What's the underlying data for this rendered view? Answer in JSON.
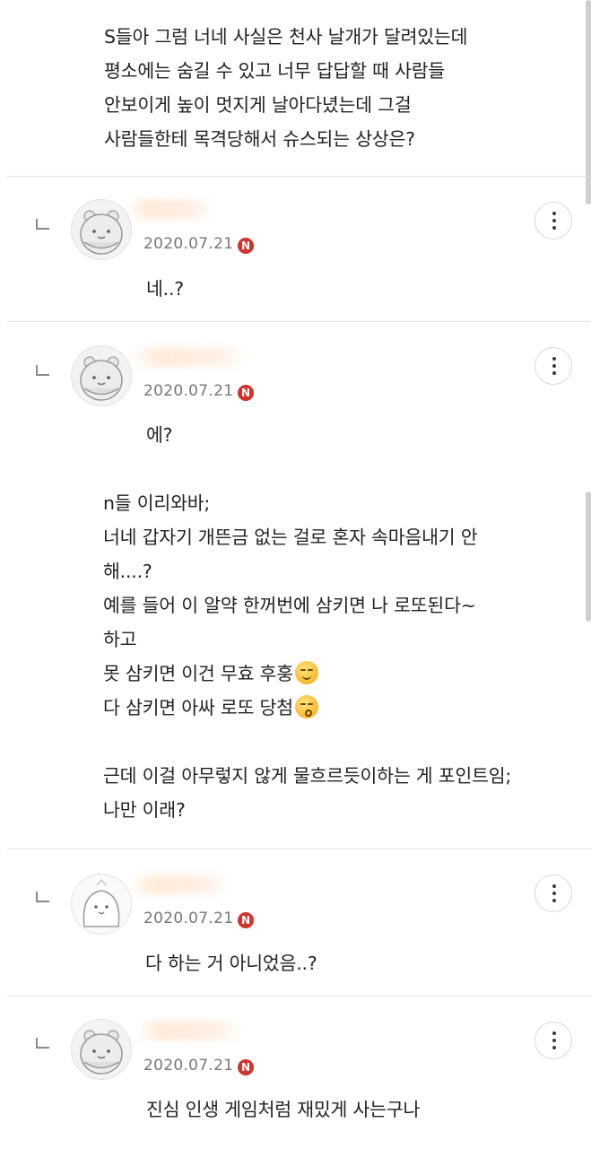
{
  "post": {
    "lines": [
      "S들아 그럼 너네 사실은 천사 날개가 달려있는데",
      "평소에는 숨길 수 있고 너무 답답할 때 사람들",
      "안보이게 높이 멋지게 날아다녔는데 그걸",
      "사람들한테 목격당해서 슈스되는 상상은?"
    ]
  },
  "comments": [
    {
      "date": "2020.07.21",
      "badge": "N",
      "text": "네..?",
      "avatar_icon": "hamster-avatar-icon"
    },
    {
      "date": "2020.07.21",
      "badge": "N",
      "text": "에?",
      "avatar_icon": "hamster-avatar-icon",
      "body_lines": [
        "n들 이리와바;",
        "너네 갑자기 개뜬금 없는 걸로 혼자 속마음내기 안",
        "해....?",
        "예를 들어 이 알약 한꺼번에 삼키면 나 로또된다~",
        "하고",
        "못 삼키면 이건 무효 후훙",
        "다 삼키면 아싸 로또 당첨",
        "",
        "근데 이걸 아무렇지 않게 물흐르듯이하는 게 포인트임;",
        "나만 이래?"
      ],
      "emojis": [
        "smirk-emoji-icon",
        "kiss-emoji-icon"
      ]
    },
    {
      "date": "2020.07.21",
      "badge": "N",
      "text": "다 하는 거 아니었음..?",
      "avatar_icon": "blob-avatar-icon"
    },
    {
      "date": "2020.07.21",
      "badge": "N",
      "text": "진심 인생 게임처럼 재밌게 사는구나",
      "avatar_icon": "hamster-avatar-icon"
    }
  ]
}
